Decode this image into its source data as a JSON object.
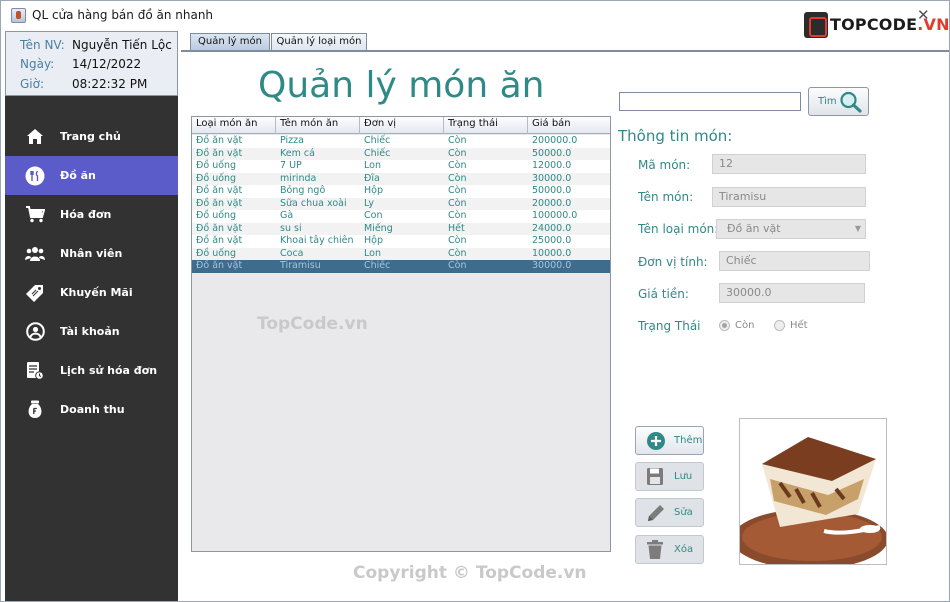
{
  "window": {
    "title": "QL cửa hàng bán đồ ăn nhanh",
    "close_glyph": "✕"
  },
  "logo": {
    "text": "TOPCODE",
    "suffix": ".VN"
  },
  "user_info": {
    "name_label": "Tên NV:",
    "name_value": "Nguyễn Tiến Lộc",
    "date_label": "Ngày:",
    "date_value": "14/12/2022",
    "time_label": "Giờ:",
    "time_value": "08:22:32 PM"
  },
  "sidebar": {
    "items": [
      {
        "label": "Trang chủ",
        "icon": "home-icon",
        "active": false
      },
      {
        "label": "Đồ ăn",
        "icon": "utensils-icon",
        "active": true
      },
      {
        "label": "Hóa đơn",
        "icon": "cart-icon",
        "active": false
      },
      {
        "label": "Nhân viên",
        "icon": "users-icon",
        "active": false
      },
      {
        "label": "Khuyến Mãi",
        "icon": "tag-icon",
        "active": false
      },
      {
        "label": "Tài khoản",
        "icon": "account-icon",
        "active": false
      },
      {
        "label": "Lịch sử hóa đơn",
        "icon": "receipt-history-icon",
        "active": false
      },
      {
        "label": "Doanh thu",
        "icon": "money-bag-icon",
        "active": false
      }
    ]
  },
  "tabs": [
    {
      "label": "Quản lý món ăn",
      "active": true
    },
    {
      "label": "Quản lý loại món ăn",
      "active": false
    }
  ],
  "page_title": "Quản lý món ăn",
  "table": {
    "headers": [
      "Loại món ăn",
      "Tên món ăn",
      "Đơn vị",
      "Trạng thái",
      "Giá bán"
    ],
    "rows": [
      [
        "Đồ ăn vặt",
        "Pizza",
        "Chiếc",
        "Còn",
        "200000.0"
      ],
      [
        "Đồ ăn vặt",
        "Kem cá",
        "Chiếc",
        "Còn",
        "50000.0"
      ],
      [
        "Đồ uống",
        "7 UP",
        "Lon",
        "Còn",
        "12000.0"
      ],
      [
        "Đồ uống",
        "mirinda",
        "Đĩa",
        "Còn",
        "30000.0"
      ],
      [
        "Đồ ăn vặt",
        "Bỏng ngô",
        "Hộp",
        "Còn",
        "50000.0"
      ],
      [
        "Đồ ăn vặt",
        "Sữa chua xoài",
        "Ly",
        "Còn",
        "20000.0"
      ],
      [
        "Đồ uống",
        "Gà",
        "Con",
        "Còn",
        "100000.0"
      ],
      [
        "Đồ ăn vặt",
        "su si",
        "Miếng",
        "Hết",
        "24000.0"
      ],
      [
        "Đồ ăn vặt",
        "Khoai tây chiên",
        "Hộp",
        "Còn",
        "25000.0"
      ],
      [
        "Đồ uống",
        "Coca",
        "Lon",
        "Còn",
        "10000.0"
      ],
      [
        "Đồ ăn vặt",
        "Tiramisu",
        "Chiếc",
        "Còn",
        "30000.0"
      ]
    ],
    "selected_index": 10
  },
  "search": {
    "value": "",
    "button_label": "Tìm"
  },
  "detail": {
    "section_title": "Thông tin món:",
    "code_label": "Mã món:",
    "code_value": "12",
    "name_label": "Tên món:",
    "name_value": "Tiramisu",
    "category_label": "Tên loại món:",
    "category_value": "Đồ ăn vặt",
    "unit_label": "Đơn vị tính:",
    "unit_value": "Chiếc",
    "price_label": "Giá tiền:",
    "price_value": "30000.0",
    "status_label": "Trạng Thái",
    "status_options": [
      "Còn",
      "Hết"
    ],
    "status_selected": "Còn"
  },
  "actions": {
    "add_label": "Thêm",
    "save_label": "Lưu",
    "edit_label": "Sửa",
    "delete_label": "Xóa"
  },
  "watermarks": {
    "center": "TopCode.vn",
    "bottom": "Copyright © TopCode.vn"
  },
  "colors": {
    "accent_teal": "#2f8a87",
    "sidebar_bg": "#323232",
    "active_item": "#5b5bc9",
    "selected_row": "#3f6b8c"
  }
}
